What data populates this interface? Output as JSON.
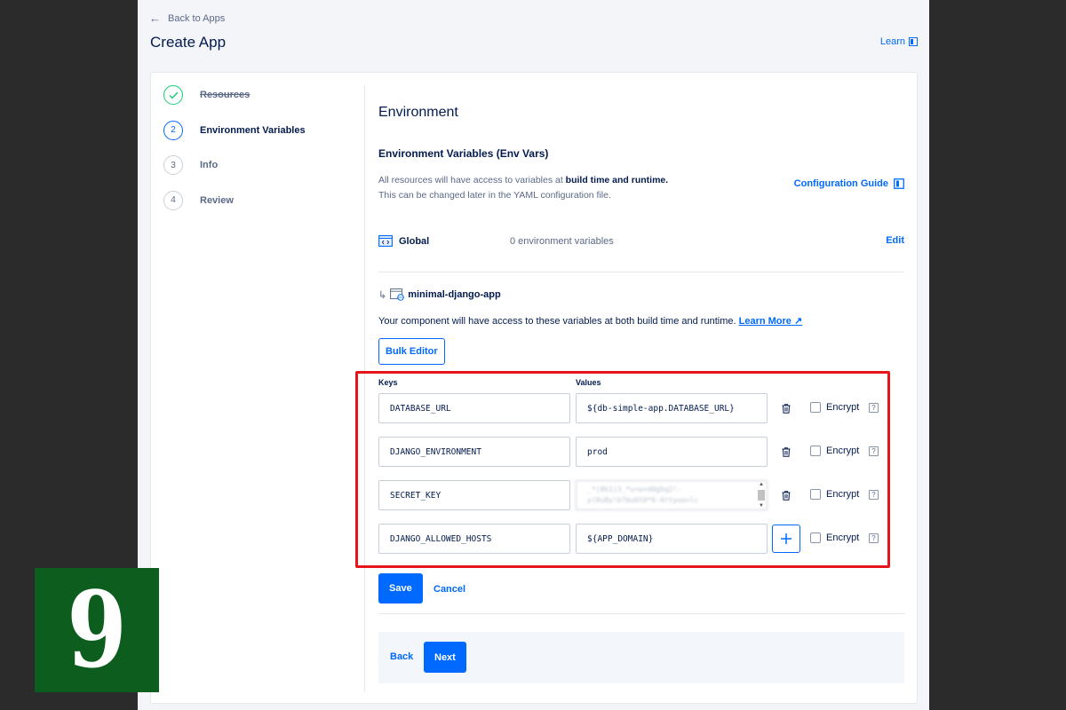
{
  "header": {
    "back_label": "Back to Apps",
    "title": "Create App",
    "learn_label": "Learn"
  },
  "steps": [
    {
      "number": "✓",
      "label": "Resources",
      "state": "done"
    },
    {
      "number": "2",
      "label": "Environment Variables",
      "state": "active"
    },
    {
      "number": "3",
      "label": "Info",
      "state": "pending"
    },
    {
      "number": "4",
      "label": "Review",
      "state": "pending"
    }
  ],
  "main": {
    "section_title": "Environment",
    "sub_title": "Environment Variables (Env Vars)",
    "desc_line1_prefix": "All resources will have access to variables at ",
    "desc_line1_bold": "build time and runtime.",
    "desc_line2": "This can be changed later in the YAML configuration file.",
    "config_guide_label": "Configuration Guide",
    "global": {
      "label": "Global",
      "count": "0 environment variables",
      "edit_label": "Edit"
    },
    "component": {
      "name": "minimal-django-app",
      "desc": "Your component will have access to these variables at both build time and runtime.",
      "learn_more": "Learn More ↗"
    },
    "bulk_editor_label": "Bulk Editor",
    "keys_header": "Keys",
    "values_header": "Values",
    "encrypt_label": "Encrypt",
    "rows": [
      {
        "key": "DATABASE_URL",
        "value": "${db-simple-app.DATABASE_URL}"
      },
      {
        "key": "DJANGO_ENVIRONMENT",
        "value": "prod"
      },
      {
        "key": "SECRET_KEY",
        "value_line1": "_*(8h1)3_*u+w+d0g5q2!-",
        "value_line2": "y(0u8y!b7bu6t0*6-4rtyuo=lc"
      },
      {
        "key": "DJANGO_ALLOWED_HOSTS",
        "value": "${APP_DOMAIN}"
      }
    ],
    "save_label": "Save",
    "cancel_label": "Cancel",
    "back_label": "Back",
    "next_label": "Next"
  },
  "overlay": {
    "step_badge": "9",
    "highlight_color": "#e8141c",
    "badge_color": "#0d5d1e"
  },
  "colors": {
    "accent": "#0069ff",
    "success": "#15cd72",
    "text_primary": "#031b4e",
    "text_secondary": "#5b6987"
  }
}
